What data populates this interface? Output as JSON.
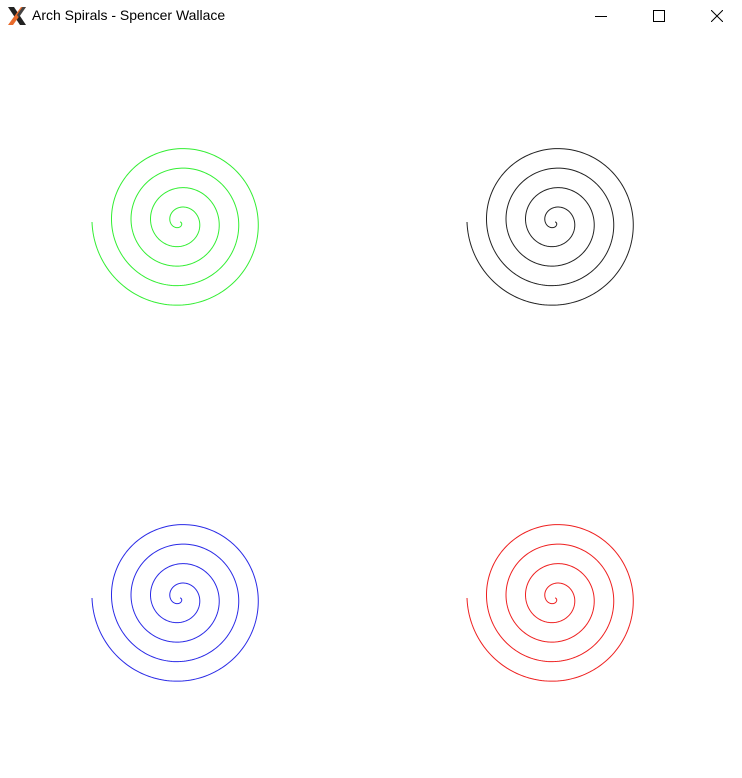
{
  "window": {
    "title": "Arch Spirals - Spencer Wallace",
    "app_icon": "x-logo-icon",
    "controls": {
      "minimize_icon": "minimize-icon",
      "maximize_icon": "maximize-icon",
      "close_icon": "close-icon"
    }
  },
  "spirals": [
    {
      "name": "spiral-top-left",
      "color": "#33ee33"
    },
    {
      "name": "spiral-top-right",
      "color": "#222222"
    },
    {
      "name": "spiral-bottom-left",
      "color": "#2a2ae6"
    },
    {
      "name": "spiral-bottom-right",
      "color": "#ee2020"
    }
  ]
}
